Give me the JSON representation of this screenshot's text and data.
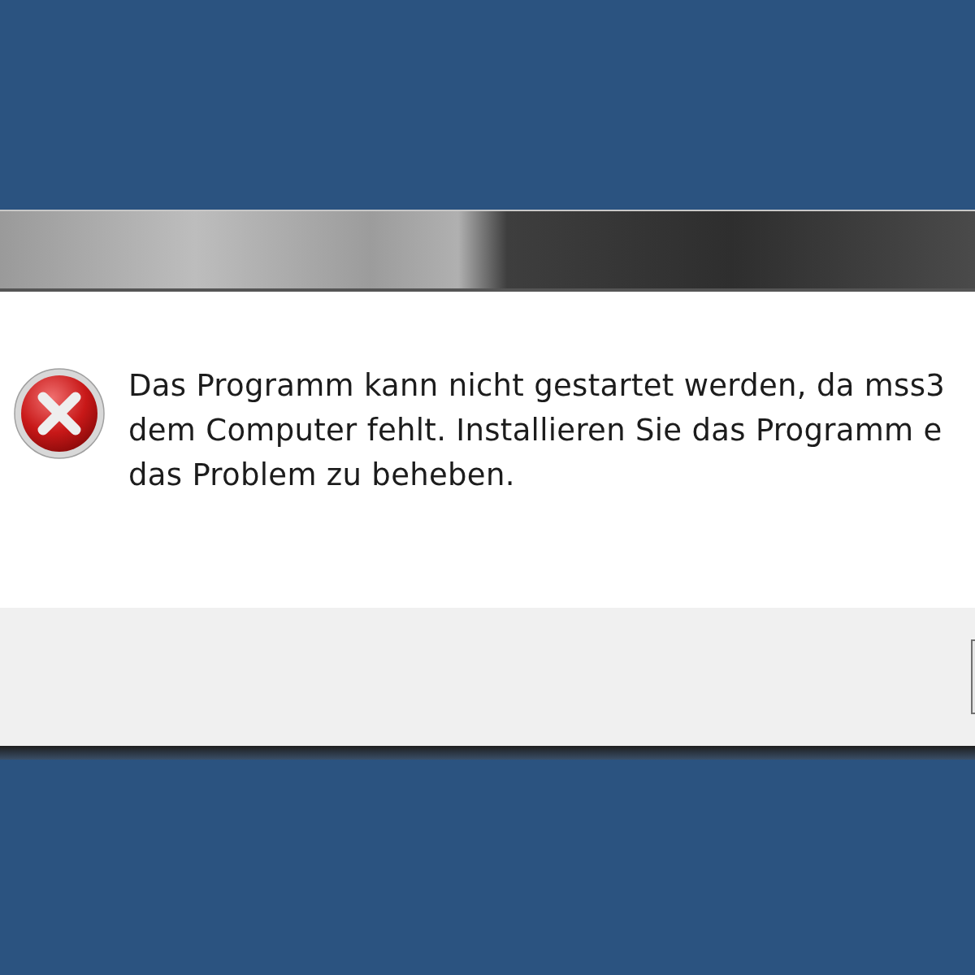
{
  "dialog": {
    "message_lines": [
      "Das Programm kann nicht gestartet werden, da mss3",
      "dem Computer fehlt. Installieren Sie das Programm e",
      "das Problem zu beheben."
    ]
  }
}
